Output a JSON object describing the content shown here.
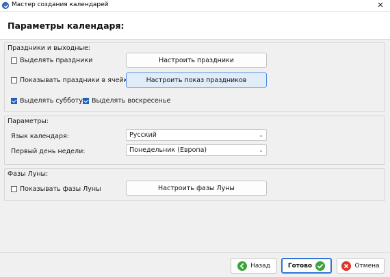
{
  "window": {
    "title": "Мастер создания календарей",
    "close_glyph": "✕",
    "icon": "app-icon"
  },
  "header": {
    "title": "Параметры календаря:"
  },
  "holidays_group": {
    "label": "Праздники и выходные:",
    "highlight_holidays": {
      "label": "Выделять праздники",
      "checked": false
    },
    "configure_holidays_button": "Настроить праздники",
    "show_holidays_in_cells": {
      "label": "Показывать праздники в ячейках",
      "checked": false
    },
    "configure_holiday_display_button": "Настроить показ праздников",
    "highlight_saturday": {
      "label": "Выделять субботу",
      "checked": true
    },
    "highlight_sunday": {
      "label": "Выделять воскресенье",
      "checked": true
    }
  },
  "params_group": {
    "label": "Параметры:",
    "language": {
      "label": "Язык календаря:",
      "value": "Русский"
    },
    "first_day": {
      "label": "Первый день недели:",
      "value": "Понедельник (Европа)"
    }
  },
  "moon_group": {
    "label": "Фазы Луны:",
    "show_moon_phases": {
      "label": "Показывать фазы Луны",
      "checked": false
    },
    "configure_moon_button": "Настроить фазы Луны"
  },
  "footer": {
    "back_button": "Назад",
    "done_button": "Готово",
    "cancel_button": "Отмена"
  },
  "colors": {
    "accent": "#1f5fc0",
    "back_icon": "#3aa63a",
    "done_icon": "#3aa63a",
    "cancel_icon": "#d93a2b"
  }
}
